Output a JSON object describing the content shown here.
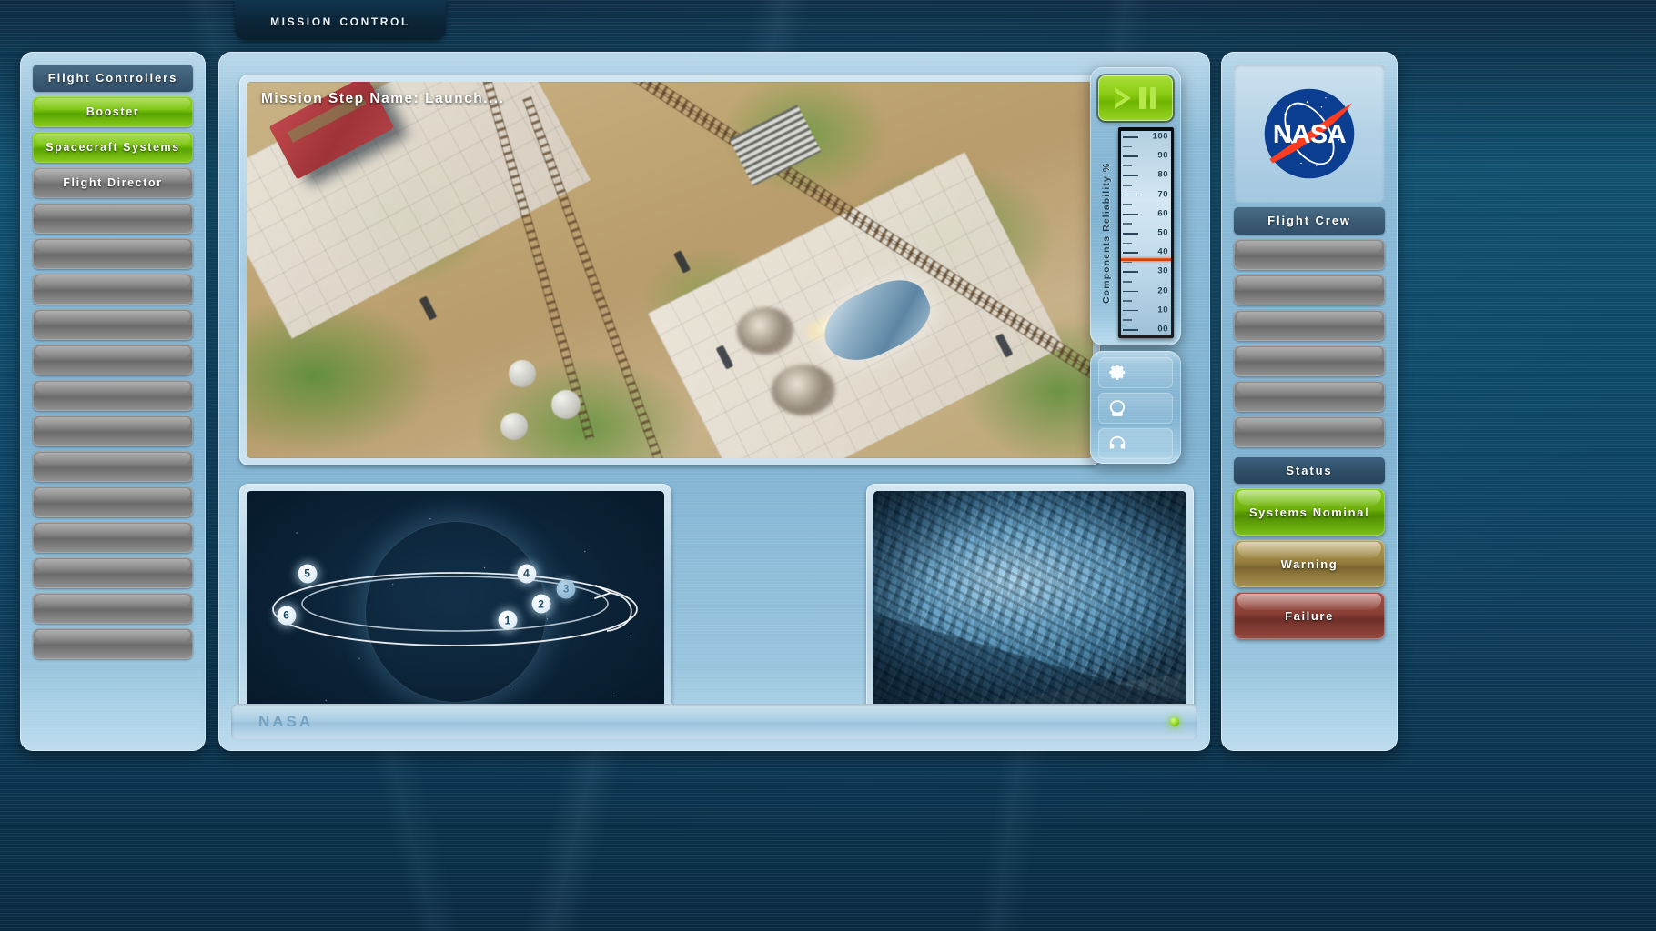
{
  "header": {
    "title": "Mission Control"
  },
  "left_sidebar": {
    "section_title": "Flight Controllers",
    "items": [
      {
        "label": "Booster",
        "state": "active"
      },
      {
        "label": "Spacecraft Systems",
        "state": "active"
      },
      {
        "label": "Flight Director",
        "state": "assigned"
      },
      {
        "label": "",
        "state": "empty"
      },
      {
        "label": "",
        "state": "empty"
      },
      {
        "label": "",
        "state": "empty"
      },
      {
        "label": "",
        "state": "empty"
      },
      {
        "label": "",
        "state": "empty"
      },
      {
        "label": "",
        "state": "empty"
      },
      {
        "label": "",
        "state": "empty"
      },
      {
        "label": "",
        "state": "empty"
      },
      {
        "label": "",
        "state": "empty"
      },
      {
        "label": "",
        "state": "empty"
      },
      {
        "label": "",
        "state": "empty"
      },
      {
        "label": "",
        "state": "empty"
      },
      {
        "label": "",
        "state": "empty"
      }
    ]
  },
  "main": {
    "launch_view": {
      "step_label": "Mission Step Name: Launch...."
    },
    "footer": {
      "logo_text": "NASA",
      "led_color": "#8fd420"
    }
  },
  "orbit": {
    "waypoints": [
      {
        "id": "1",
        "active": false
      },
      {
        "id": "2",
        "active": false
      },
      {
        "id": "3",
        "active": true
      },
      {
        "id": "4",
        "active": false
      },
      {
        "id": "5",
        "active": false
      },
      {
        "id": "6",
        "active": false
      }
    ]
  },
  "controls": {
    "play_icon": "play-icon",
    "pause_icon": "pause-icon",
    "gauge": {
      "label": "Components Reliability %",
      "ticks": [
        "100",
        "90",
        "80",
        "70",
        "60",
        "50",
        "40",
        "30",
        "20",
        "10",
        "00"
      ],
      "value": 37,
      "min": 0,
      "max": 100,
      "needle_color": "#c83c0a"
    },
    "icon_buttons": [
      {
        "icon": "gear-icon",
        "name": "settings"
      },
      {
        "icon": "helmet-icon",
        "name": "helmet"
      },
      {
        "icon": "headset-icon",
        "name": "comms"
      }
    ]
  },
  "right_sidebar": {
    "logo_alt": "NASA",
    "crew_title": "Flight Crew",
    "crew_slots": [
      "",
      "",
      "",
      "",
      "",
      ""
    ],
    "status_title": "Status",
    "status_buttons": [
      {
        "label": "Systems Nominal",
        "color": "#6cb00a"
      },
      {
        "label": "Warning",
        "color": "#98813f"
      },
      {
        "label": "Failure",
        "color": "#8a3f36"
      }
    ]
  }
}
